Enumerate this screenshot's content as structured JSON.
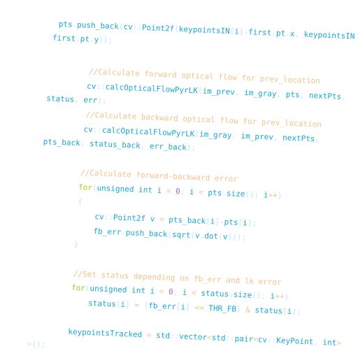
{
  "colors": {
    "ident": "#1aa7d6",
    "punct": "#bde7f4",
    "comment": "#f2c48a",
    "keyword": "#9ccf1f",
    "number": "#a86bd0",
    "operator": "#f2c48a",
    "background": "#ffffff"
  },
  "code_lines": [
    {
      "tokens": [
        {
          "t": "pts",
          "k": "ident"
        },
        {
          "t": ".",
          "k": "punct"
        },
        {
          "t": "push_back",
          "k": "ident"
        },
        {
          "t": "(",
          "k": "punct"
        },
        {
          "t": "cv",
          "k": "ident"
        },
        {
          "t": "::",
          "k": "punct"
        },
        {
          "t": "Point2f",
          "k": "ident"
        },
        {
          "t": "(",
          "k": "punct"
        },
        {
          "t": "keypointsIN",
          "k": "ident"
        },
        {
          "t": "[",
          "k": "punct"
        },
        {
          "t": "i",
          "k": "ident"
        },
        {
          "t": "].",
          "k": "punct"
        },
        {
          "t": "first",
          "k": "ident"
        },
        {
          "t": ".",
          "k": "punct"
        },
        {
          "t": "pt",
          "k": "ident"
        },
        {
          "t": ".",
          "k": "punct"
        },
        {
          "t": "x",
          "k": "ident"
        },
        {
          "t": ", ",
          "k": "punct"
        },
        {
          "t": "keypointsIN",
          "k": "ident"
        }
      ]
    },
    {
      "tokens": [
        {
          "t": "first",
          "k": "ident"
        },
        {
          "t": ".",
          "k": "punct"
        },
        {
          "t": "pt",
          "k": "ident"
        },
        {
          "t": ".",
          "k": "punct"
        },
        {
          "t": "y",
          "k": "ident"
        },
        {
          "t": "));",
          "k": "punct"
        }
      ]
    },
    {
      "tokens": [
        {
          "t": "//Calculate forward optical flow for prev_location",
          "k": "comment"
        }
      ]
    },
    {
      "tokens": [
        {
          "t": "cv",
          "k": "ident"
        },
        {
          "t": "::",
          "k": "punct"
        },
        {
          "t": "calcOpticalFlowPyrLK",
          "k": "ident"
        },
        {
          "t": "(",
          "k": "punct"
        },
        {
          "t": "im_prev",
          "k": "ident"
        },
        {
          "t": ", ",
          "k": "punct"
        },
        {
          "t": "im_gray",
          "k": "ident"
        },
        {
          "t": ", ",
          "k": "punct"
        },
        {
          "t": "pts",
          "k": "ident"
        },
        {
          "t": ", ",
          "k": "punct"
        },
        {
          "t": "nextPts",
          "k": "ident"
        },
        {
          "t": ",",
          "k": "punct"
        }
      ]
    },
    {
      "tokens": [
        {
          "t": "status",
          "k": "ident"
        },
        {
          "t": ", ",
          "k": "punct"
        },
        {
          "t": "err",
          "k": "ident"
        },
        {
          "t": ");",
          "k": "punct"
        }
      ]
    },
    {
      "tokens": [
        {
          "t": "//Calculate backward optical flow for prev_location",
          "k": "comment"
        }
      ]
    },
    {
      "tokens": [
        {
          "t": "cv",
          "k": "ident"
        },
        {
          "t": "::",
          "k": "punct"
        },
        {
          "t": "calcOpticalFlowPyrLK",
          "k": "ident"
        },
        {
          "t": "(",
          "k": "punct"
        },
        {
          "t": "im_gray",
          "k": "ident"
        },
        {
          "t": ", ",
          "k": "punct"
        },
        {
          "t": "im_prev",
          "k": "ident"
        },
        {
          "t": ", ",
          "k": "punct"
        },
        {
          "t": "nextPts",
          "k": "ident"
        },
        {
          "t": ",",
          "k": "punct"
        }
      ]
    },
    {
      "tokens": [
        {
          "t": "pts_back",
          "k": "ident"
        },
        {
          "t": ", ",
          "k": "punct"
        },
        {
          "t": "status_back",
          "k": "ident"
        },
        {
          "t": ", ",
          "k": "punct"
        },
        {
          "t": "err_back",
          "k": "ident"
        },
        {
          "t": ");",
          "k": "punct"
        }
      ]
    },
    {
      "tokens": [
        {
          "t": "//Calculate forward-backward error",
          "k": "comment"
        }
      ]
    },
    {
      "tokens": [
        {
          "t": "for",
          "k": "keyword"
        },
        {
          "t": "(",
          "k": "punct"
        },
        {
          "t": "unsigned int",
          "k": "ident"
        },
        {
          "t": " ",
          "k": "punct"
        },
        {
          "t": "i",
          "k": "ident"
        },
        {
          "t": " = ",
          "k": "operator"
        },
        {
          "t": "0",
          "k": "number"
        },
        {
          "t": "; ",
          "k": "punct"
        },
        {
          "t": "i",
          "k": "ident"
        },
        {
          "t": " < ",
          "k": "operator"
        },
        {
          "t": "pts",
          "k": "ident"
        },
        {
          "t": ".",
          "k": "punct"
        },
        {
          "t": "size",
          "k": "ident"
        },
        {
          "t": "(); ",
          "k": "punct"
        },
        {
          "t": "i",
          "k": "ident"
        },
        {
          "t": "++",
          "k": "operator"
        },
        {
          "t": ")",
          "k": "punct"
        }
      ]
    },
    {
      "tokens": [
        {
          "t": "{",
          "k": "punct"
        }
      ]
    },
    {
      "tokens": [
        {
          "t": "cv",
          "k": "ident"
        },
        {
          "t": "::",
          "k": "punct"
        },
        {
          "t": "Point2f",
          "k": "ident"
        },
        {
          "t": " ",
          "k": "punct"
        },
        {
          "t": "v",
          "k": "ident"
        },
        {
          "t": " = ",
          "k": "operator"
        },
        {
          "t": "pts_back",
          "k": "ident"
        },
        {
          "t": "[",
          "k": "punct"
        },
        {
          "t": "i",
          "k": "ident"
        },
        {
          "t": "]",
          "k": "punct"
        },
        {
          "t": "-",
          "k": "operator"
        },
        {
          "t": "pts",
          "k": "ident"
        },
        {
          "t": "[",
          "k": "punct"
        },
        {
          "t": "i",
          "k": "ident"
        },
        {
          "t": "];",
          "k": "punct"
        }
      ]
    },
    {
      "tokens": [
        {
          "t": "fb_err",
          "k": "ident"
        },
        {
          "t": ".",
          "k": "punct"
        },
        {
          "t": "push_back",
          "k": "ident"
        },
        {
          "t": "(",
          "k": "punct"
        },
        {
          "t": "sqrt",
          "k": "ident"
        },
        {
          "t": "(",
          "k": "punct"
        },
        {
          "t": "v",
          "k": "ident"
        },
        {
          "t": ".",
          "k": "punct"
        },
        {
          "t": "dot",
          "k": "ident"
        },
        {
          "t": "(",
          "k": "punct"
        },
        {
          "t": "v",
          "k": "ident"
        },
        {
          "t": ")));",
          "k": "punct"
        }
      ]
    },
    {
      "tokens": [
        {
          "t": "}",
          "k": "punct"
        }
      ]
    },
    {
      "tokens": [
        {
          "t": "//Set status depending on fb_err and lk error",
          "k": "comment"
        }
      ]
    },
    {
      "tokens": [
        {
          "t": "for",
          "k": "keyword"
        },
        {
          "t": "(",
          "k": "punct"
        },
        {
          "t": "unsigned int",
          "k": "ident"
        },
        {
          "t": " ",
          "k": "punct"
        },
        {
          "t": "i",
          "k": "ident"
        },
        {
          "t": " = ",
          "k": "operator"
        },
        {
          "t": "0",
          "k": "number"
        },
        {
          "t": "; ",
          "k": "punct"
        },
        {
          "t": "i",
          "k": "ident"
        },
        {
          "t": " < ",
          "k": "operator"
        },
        {
          "t": "status",
          "k": "ident"
        },
        {
          "t": ".",
          "k": "punct"
        },
        {
          "t": "size",
          "k": "ident"
        },
        {
          "t": "(); ",
          "k": "punct"
        },
        {
          "t": "i",
          "k": "ident"
        },
        {
          "t": "++",
          "k": "operator"
        },
        {
          "t": ")",
          "k": "punct"
        }
      ]
    },
    {
      "tokens": [
        {
          "t": "status",
          "k": "ident"
        },
        {
          "t": "[",
          "k": "punct"
        },
        {
          "t": "i",
          "k": "ident"
        },
        {
          "t": "]",
          "k": "punct"
        },
        {
          "t": " = ",
          "k": "operator"
        },
        {
          "t": "(",
          "k": "punct"
        },
        {
          "t": "fb_err",
          "k": "ident"
        },
        {
          "t": "[",
          "k": "punct"
        },
        {
          "t": "i",
          "k": "ident"
        },
        {
          "t": "]",
          "k": "punct"
        },
        {
          "t": " <= ",
          "k": "operator"
        },
        {
          "t": "THR_FB",
          "k": "ident"
        },
        {
          "t": ")",
          "k": "punct"
        },
        {
          "t": " & ",
          "k": "operator"
        },
        {
          "t": "status",
          "k": "ident"
        },
        {
          "t": "[",
          "k": "punct"
        },
        {
          "t": "i",
          "k": "ident"
        },
        {
          "t": "];",
          "k": "punct"
        }
      ]
    },
    {
      "tokens": [
        {
          "t": "keypointsTracked",
          "k": "ident"
        },
        {
          "t": " = ",
          "k": "operator"
        },
        {
          "t": "std",
          "k": "ident"
        },
        {
          "t": "::",
          "k": "punct"
        },
        {
          "t": "vector",
          "k": "ident"
        },
        {
          "t": "<",
          "k": "operator"
        },
        {
          "t": "std",
          "k": "ident"
        },
        {
          "t": "::",
          "k": "punct"
        },
        {
          "t": "pair",
          "k": "ident"
        },
        {
          "t": "<",
          "k": "operator"
        },
        {
          "t": "cv",
          "k": "ident"
        },
        {
          "t": "::",
          "k": "punct"
        },
        {
          "t": "KeyPoint",
          "k": "ident"
        },
        {
          "t": ", ",
          "k": "punct"
        },
        {
          "t": "int",
          "k": "ident"
        },
        {
          "t": ">",
          "k": "operator"
        }
      ]
    },
    {
      "tokens": [
        {
          "t": ">();",
          "k": "punct"
        }
      ]
    }
  ]
}
